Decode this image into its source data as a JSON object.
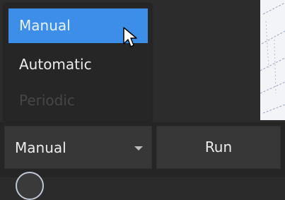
{
  "mode_dropdown": {
    "options": [
      {
        "label": "Manual",
        "state": "selected"
      },
      {
        "label": "Automatic",
        "state": "normal"
      },
      {
        "label": "Periodic",
        "state": "disabled"
      }
    ],
    "current_value": "Manual",
    "arrow_icon": "chevron-down-icon"
  },
  "run_button": {
    "label": "Run"
  },
  "colors": {
    "selection": "#3d8ee8",
    "panel": "#2c2c2c",
    "button": "#373737",
    "text": "#ececec",
    "disabled_text": "#464646"
  }
}
